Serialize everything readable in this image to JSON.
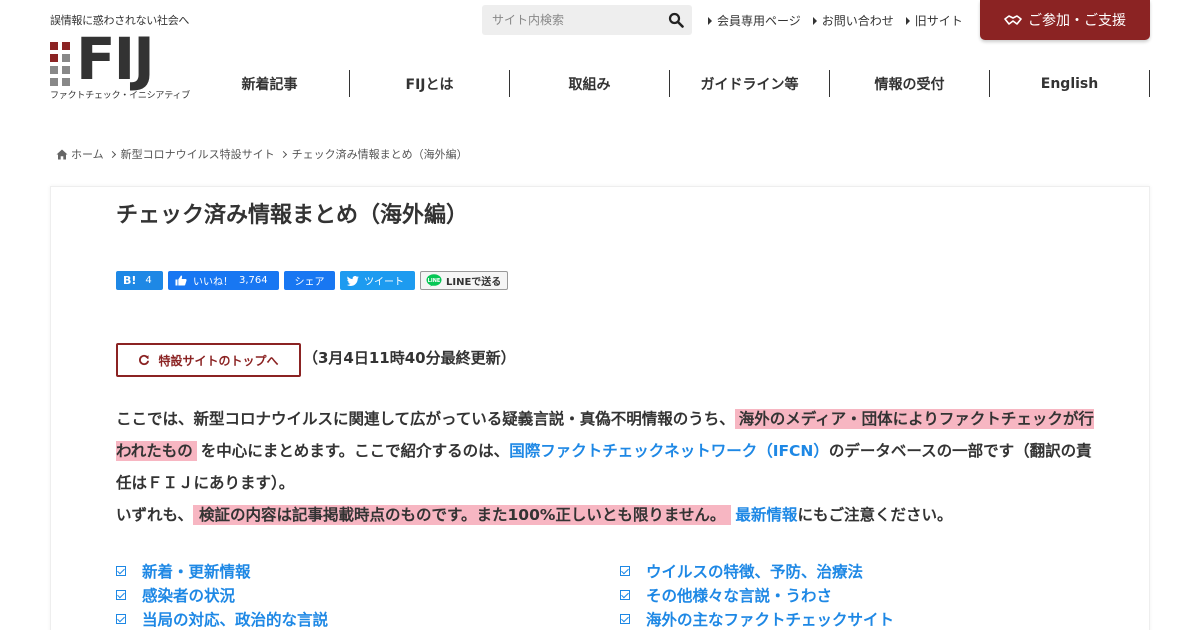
{
  "header": {
    "tagline": "誤情報に惑わされない社会へ",
    "logo_text": "FIJ",
    "logo_subtitle": "ファクトチェック・イニシアティブ",
    "search_placeholder": "サイト内検索",
    "top_links": [
      "会員専用ページ",
      "お問い合わせ",
      "旧サイト"
    ],
    "join_label": "ご参加・ご支援",
    "nav": [
      "新着記事",
      "FIJとは",
      "取組み",
      "ガイドライン等",
      "情報の受付",
      "English"
    ],
    "colors": {
      "brand": "#8b2323",
      "logo_gray": "#888888"
    }
  },
  "breadcrumb": [
    "ホーム",
    "新型コロナウイルス特設サイト",
    "チェック済み情報まとめ（海外編）"
  ],
  "article": {
    "title": "チェック済み情報まとめ（海外編）",
    "share": {
      "hatena_count": "4",
      "like_label": "いいね！",
      "like_count": "3,764",
      "share_label": "シェア",
      "tweet_label": "ツイート",
      "line_label": "LINEで送る"
    },
    "top_button_label": "特設サイトのトップへ",
    "updated": "（3月4日11時40分最終更新）",
    "intro": {
      "p1_a": "ここでは、新型コロナウイルスに関連して広がっている疑義言説・真偽不明情報のうち、",
      "p1_hl": "海外のメディア・団体によりファクトチェックが行われたもの",
      "p1_b": "を中心にまとめます。ここで紹介するのは、",
      "p1_link": "国際ファクトチェックネットワーク（IFCN）",
      "p1_c": "のデータベースの一部です（翻訳の責任はＦＩＪにあります）。",
      "p2_a": "いずれも、",
      "p2_hl": "検証の内容は記事掲載時点のものです。また100%正しいとも限りません。",
      "p2_link": "最新情報",
      "p2_b": "にもご注意ください。"
    },
    "toc": [
      "新着・更新情報",
      "ウイルスの特徴、予防、治療法",
      "感染者の状況",
      "その他様々な言説・うわさ",
      "当局の対応、政治的な言説",
      "海外の主なファクトチェックサイト"
    ],
    "colors": {
      "highlight": "#f7b6c2",
      "link": "#1e88e5"
    }
  }
}
